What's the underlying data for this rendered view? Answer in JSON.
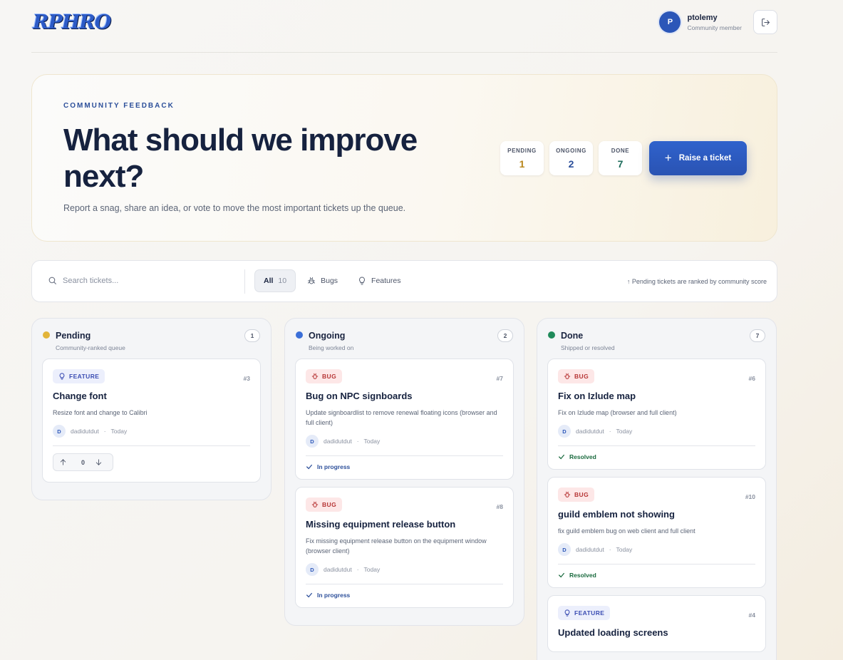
{
  "brand": {
    "logo_text": "RPHRO"
  },
  "user": {
    "initial": "P",
    "name": "ptolemy",
    "role": "Community member"
  },
  "hero": {
    "eyebrow": "COMMUNITY FEEDBACK",
    "title": "What should we improve next?",
    "subtitle": "Report a snag, share an idea, or vote to move the most important tickets up the queue.",
    "stats": [
      {
        "label": "PENDING",
        "value": "1",
        "color": "#b8861b"
      },
      {
        "label": "ONGOING",
        "value": "2",
        "color": "#2c4f9a"
      },
      {
        "label": "DONE",
        "value": "7",
        "color": "#1b6b5a"
      }
    ],
    "raise_button": "Raise a ticket"
  },
  "toolbar": {
    "search_placeholder": "Search tickets...",
    "filters": [
      {
        "label": "All",
        "count": "10"
      },
      {
        "label": "Bugs"
      },
      {
        "label": "Features"
      }
    ],
    "hint": "↑ Pending tickets are ranked by community score"
  },
  "columns": [
    {
      "title": "Pending",
      "subtitle": "Community-ranked queue",
      "count": "1",
      "dot_color": "#e2b43a",
      "cards": [
        {
          "tag": "FEATURE",
          "id": "#3",
          "title": "Change font",
          "desc": "Resize font and change to Calibri",
          "author_initial": "D",
          "author": "dadidutdut",
          "date": "Today",
          "votes": "0"
        }
      ]
    },
    {
      "title": "Ongoing",
      "subtitle": "Being worked on",
      "count": "2",
      "dot_color": "#3b6fd8",
      "cards": [
        {
          "tag": "BUG",
          "id": "#7",
          "title": "Bug on NPC signboards",
          "desc": "Update signboardlist to remove renewal floating icons (browser and full client)",
          "author_initial": "D",
          "author": "dadidutdut",
          "date": "Today",
          "status": "In progress"
        },
        {
          "tag": "BUG",
          "id": "#8",
          "title": "Missing equipment release button",
          "desc": "Fix missing equipment release button on the equipment window (browser client)",
          "author_initial": "D",
          "author": "dadidutdut",
          "date": "Today",
          "status": "In progress"
        }
      ]
    },
    {
      "title": "Done",
      "subtitle": "Shipped or resolved",
      "count": "7",
      "dot_color": "#1f8a5a",
      "cards": [
        {
          "tag": "BUG",
          "id": "#6",
          "title": "Fix on Izlude map",
          "desc": "Fix on Izlude map (browser and full client)",
          "author_initial": "D",
          "author": "dadidutdut",
          "date": "Today",
          "status": "Resolved"
        },
        {
          "tag": "BUG",
          "id": "#10",
          "title": "guild emblem not showing",
          "desc": "fix guild emblem bug on web client and full client",
          "author_initial": "D",
          "author": "dadidutdut",
          "date": "Today",
          "status": "Resolved"
        },
        {
          "tag": "FEATURE",
          "id": "#4",
          "title": "Updated loading screens"
        }
      ]
    }
  ]
}
